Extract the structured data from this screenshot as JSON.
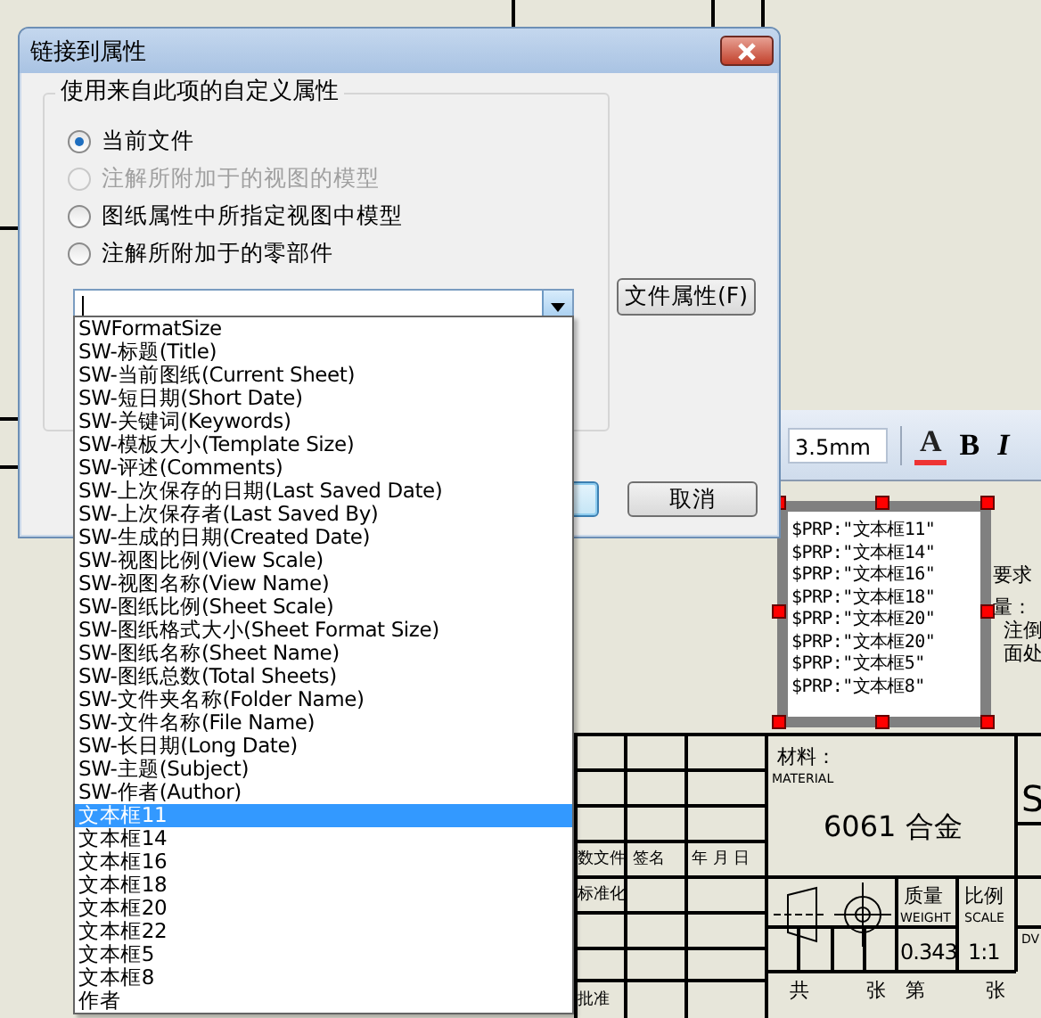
{
  "window": {
    "title": "链接到属性"
  },
  "group": {
    "legend": "使用来自此项的自定义属性",
    "options": [
      {
        "label": "当前文件",
        "selected": true,
        "disabled": false
      },
      {
        "label": "注解所附加于的视图的模型",
        "selected": false,
        "disabled": true
      },
      {
        "label": "图纸属性中所指定视图中模型",
        "selected": false,
        "disabled": false
      },
      {
        "label": "注解所附加于的零部件",
        "selected": false,
        "disabled": false
      }
    ]
  },
  "combo": {
    "expanded": true
  },
  "dropdown_items": [
    {
      "label": "SWFormatSize",
      "selected": false
    },
    {
      "label": "SW-标题(Title)",
      "selected": false
    },
    {
      "label": "SW-当前图纸(Current Sheet)",
      "selected": false
    },
    {
      "label": "SW-短日期(Short Date)",
      "selected": false
    },
    {
      "label": "SW-关键词(Keywords)",
      "selected": false
    },
    {
      "label": "SW-模板大小(Template Size)",
      "selected": false
    },
    {
      "label": "SW-评述(Comments)",
      "selected": false
    },
    {
      "label": "SW-上次保存的日期(Last Saved Date)",
      "selected": false
    },
    {
      "label": "SW-上次保存者(Last Saved By)",
      "selected": false
    },
    {
      "label": "SW-生成的日期(Created Date)",
      "selected": false
    },
    {
      "label": "SW-视图比例(View Scale)",
      "selected": false
    },
    {
      "label": "SW-视图名称(View Name)",
      "selected": false
    },
    {
      "label": "SW-图纸比例(Sheet Scale)",
      "selected": false
    },
    {
      "label": "SW-图纸格式大小(Sheet Format Size)",
      "selected": false
    },
    {
      "label": "SW-图纸名称(Sheet Name)",
      "selected": false
    },
    {
      "label": "SW-图纸总数(Total Sheets)",
      "selected": false
    },
    {
      "label": "SW-文件夹名称(Folder Name)",
      "selected": false
    },
    {
      "label": "SW-文件名称(File Name)",
      "selected": false
    },
    {
      "label": "SW-长日期(Long Date)",
      "selected": false
    },
    {
      "label": "SW-主题(Subject)",
      "selected": false
    },
    {
      "label": "SW-作者(Author)",
      "selected": false
    },
    {
      "label": "文本框11",
      "selected": true
    },
    {
      "label": "文本框14",
      "selected": false
    },
    {
      "label": "文本框16",
      "selected": false
    },
    {
      "label": "文本框18",
      "selected": false
    },
    {
      "label": "文本框20",
      "selected": false
    },
    {
      "label": "文本框22",
      "selected": false
    },
    {
      "label": "文本框5",
      "selected": false
    },
    {
      "label": "文本框8",
      "selected": false
    },
    {
      "label": "作者",
      "selected": false
    }
  ],
  "buttons": [
    {
      "label": "文件属性(F)"
    },
    {
      "label": "取消"
    }
  ],
  "toolbar": {
    "font_size": "3.5mm",
    "format_buttons": [
      "A",
      "B",
      "I"
    ]
  },
  "note_box": {
    "lines": [
      "$PRP:\"文本框11\"",
      "$PRP:\"文本框14\"",
      "$PRP:\"文本框16\"",
      "$PRP:\"文本框18\"",
      "$PRP:\"文本框20\"",
      "$PRP:\"文本框20\"",
      "$PRP:\"文本框5\"",
      "$PRP:\"文本框8\""
    ]
  },
  "drawing_notes": [
    "要求",
    "量：",
    "注倒",
    "面处"
  ],
  "title_block": {
    "material_label": "材料：",
    "material_label_en": "MATERIAL",
    "material": "6061 合金",
    "sign_headers": [
      "数文件",
      "签名",
      "年 月 日"
    ],
    "standardization": "标准化",
    "approve": "批准",
    "weight_label": "质量",
    "weight_label_en": "WEIGHT",
    "scale_label": "比例",
    "scale_label_en": "SCALE",
    "weight": "0.343",
    "scale": "1:1",
    "sheet_count": [
      "共",
      "张",
      "第",
      "张"
    ],
    "sheet_letter": "S",
    "code_label": "DV"
  }
}
